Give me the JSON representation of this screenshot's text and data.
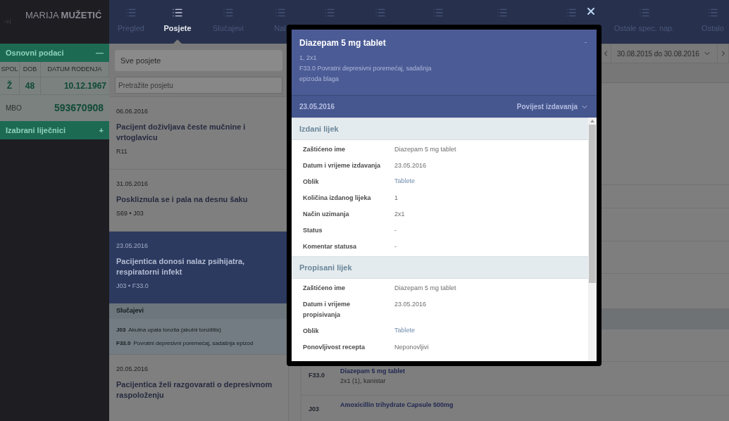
{
  "sidebar": {
    "patient_name": "MARIJA **MUŽETIĆ**",
    "basic_info": {
      "title": "Osnovni podaci",
      "toggle": "—",
      "columns": [
        "SPOL",
        "DOB",
        "DATUM ROĐENJA"
      ],
      "values": [
        "Ž",
        "48",
        "10.12.1967"
      ],
      "id_label": "MBO",
      "id_value": "593670908"
    },
    "doctors": {
      "title": "Izabrani liječnici",
      "toggle": "+"
    }
  },
  "tabs": [
    {
      "label": "Pregled",
      "selected": false
    },
    {
      "label": "Posjete",
      "selected": true
    },
    {
      "label": "Slučajevi",
      "selected": false
    },
    {
      "label": "Nal",
      "selected": false
    },
    {
      "selected": false
    },
    {
      "selected": false
    },
    {
      "selected": false
    },
    {
      "selected": false
    },
    {
      "selected": false
    },
    {
      "label": "Ostale spec. nap.",
      "selected": false
    },
    {
      "label": "Ostalo",
      "selected": false
    }
  ],
  "visit_filter": {
    "value": "Sve posjete"
  },
  "search": {
    "placeholder": "Pretražite posjetu"
  },
  "date_range": {
    "value": "30.08.2015 do 30.08.2016"
  },
  "visits": [
    {
      "date": "06.06.2016",
      "title": "Pacijent doživljava česte mučnine i vrtoglavicu",
      "codes": "R11",
      "selected": false
    },
    {
      "date": "31.05.2016",
      "title": "Poskliznula se i pala na desnu šaku",
      "codes": "S69 • J03",
      "selected": false
    },
    {
      "date": "23.05.2016",
      "title": "Pacijentica donosi nalaz psihijatra, respiratorni infekt",
      "codes": "J03 • F33.0",
      "selected": true,
      "cases": {
        "title": "Slučajevi",
        "items": [
          {
            "code": "J03",
            "text": "Akutna upala tonzila (akutni tonzilitis)"
          },
          {
            "code": "F33.0",
            "text": "Povratni depresivni poremećaj, sadašnja epizod"
          }
        ]
      }
    },
    {
      "date": "20.05.2016",
      "title": "Pacijentica želi razgovarati o depresivnom raspoloženju",
      "selected": false
    }
  ],
  "prescriptions": [
    {
      "code": "F33.0",
      "name": "Diazepam 5 mg tablet",
      "detail": "2x1 (1), kanistar"
    },
    {
      "code": "J03",
      "name": "Amoxicillin trihydrate Capsule 500mg"
    }
  ],
  "modal": {
    "title": "Diazepam 5 mg tablet",
    "dose": "1, 2x1",
    "diagnosis": "F33.0 Povratni depresivni poremećaj, sadašnja epizoda blaga",
    "minimize": "-",
    "date": "23.05.2016",
    "history_link": "Povijest izdavanja",
    "sections": [
      {
        "title": "Izdani lijek",
        "rows": [
          {
            "label": "Zaštićeno ime",
            "value": "Diazepam 5 mg tablet",
            "kind": "text"
          },
          {
            "label": "Datum i vrijeme izdavanja",
            "value": "23.05.2016",
            "kind": "text"
          },
          {
            "label": "Oblik",
            "value": "Tablete",
            "kind": "link"
          },
          {
            "label": "Količina izdanog lijeka",
            "value": "1",
            "kind": "text"
          },
          {
            "label": "Način uzimanja",
            "value": "2x1",
            "kind": "text"
          },
          {
            "label": "Status",
            "value": "-",
            "kind": "text"
          },
          {
            "label": "Komentar statusa",
            "value": "-",
            "kind": "text"
          }
        ]
      },
      {
        "title": "Propisani lijek",
        "rows": [
          {
            "label": "Zaštićeno ime",
            "value": "Diazepam 5 mg tablet",
            "kind": "text"
          },
          {
            "label": "Datum i vrijeme propisivanja",
            "value": "23.05.2016",
            "kind": "text"
          },
          {
            "label": "Oblik",
            "value": "Tablete",
            "kind": "link"
          },
          {
            "label": "Ponovljivost recepta",
            "value": "Neponovljivi",
            "kind": "text"
          }
        ]
      }
    ]
  }
}
